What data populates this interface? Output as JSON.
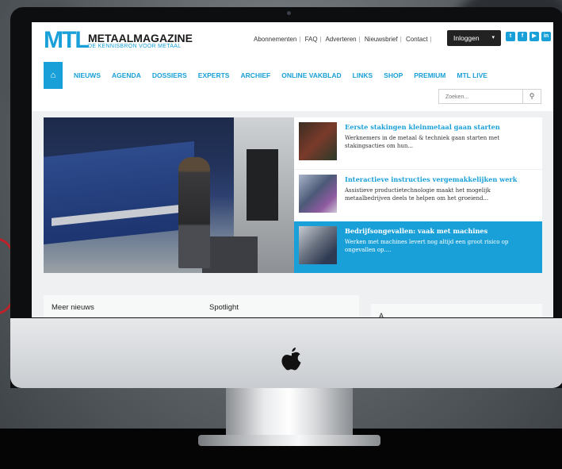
{
  "site": {
    "logo_mark": "MTL",
    "logo_name": "METAALMAGAZINE",
    "logo_tagline": "DE KENNISBRON VOOR METAAL"
  },
  "top_links": [
    "Abonnementen",
    "FAQ",
    "Adverteren",
    "Nieuwsbrief",
    "Contact"
  ],
  "login": {
    "label": "Inloggen",
    "caret": "▾"
  },
  "social_icons": [
    "twitter-icon",
    "facebook-icon",
    "youtube-icon",
    "linkedin-icon"
  ],
  "nav": {
    "home_icon": "home-icon",
    "items": [
      "NIEUWS",
      "AGENDA",
      "DOSSIERS",
      "EXPERTS",
      "ARCHIEF",
      "ONLINE VAKBLAD",
      "LINKS",
      "SHOP",
      "PREMIUM",
      "MTL LIVE"
    ]
  },
  "search": {
    "placeholder": "Zoeken...",
    "icon": "search-icon"
  },
  "news": [
    {
      "title": "Eerste stakingen kleinmetaal gaan starten",
      "desc": "Werknemers in de metaal & techniek gaan starten met stakingsacties om hun..."
    },
    {
      "title": "Interactieve instructies vergemakkelijken werk",
      "desc": "Assistieve productietechnologie maakt het mogelijk metaalbedrijven deels te helpen om het groeiend..."
    },
    {
      "title": "Bedrijfsongevallen: vaak met machines",
      "desc": "Werken met machines levert nog altijd een groot risico op ongevallen op...."
    }
  ],
  "sections": {
    "more_news": "Meer nieuws",
    "spotlight": "Spotlight",
    "partial": "A"
  }
}
